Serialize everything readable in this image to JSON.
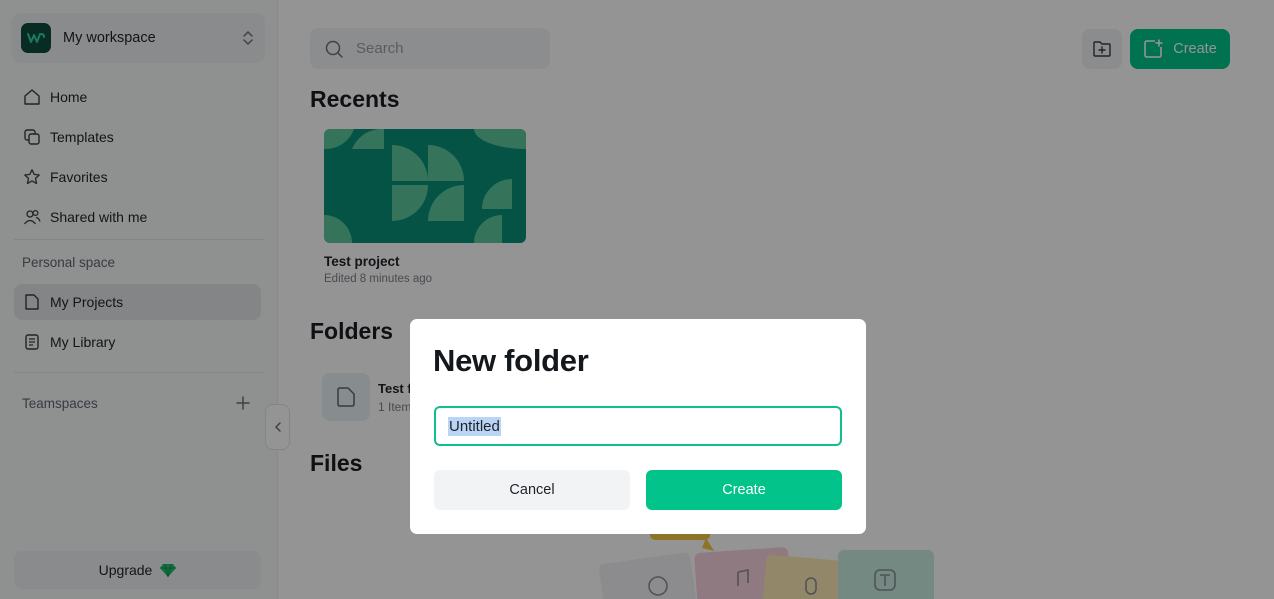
{
  "workspace": {
    "name": "My workspace"
  },
  "sidebar": {
    "nav": [
      {
        "label": "Home",
        "icon": "home-icon"
      },
      {
        "label": "Templates",
        "icon": "templates-icon"
      },
      {
        "label": "Favorites",
        "icon": "star-icon"
      },
      {
        "label": "Shared with me",
        "icon": "users-icon"
      }
    ],
    "personal_label": "Personal space",
    "personal": [
      {
        "label": "My Projects",
        "icon": "projects-icon",
        "active": true
      },
      {
        "label": "My Library",
        "icon": "library-icon",
        "active": false
      }
    ],
    "teamspaces_label": "Teamspaces",
    "upgrade_label": "Upgrade"
  },
  "header": {
    "search_placeholder": "Search",
    "create_label": "Create"
  },
  "recents": {
    "title": "Recents",
    "items": [
      {
        "name": "Test project",
        "edited": "Edited 8 minutes ago"
      }
    ]
  },
  "folders": {
    "title": "Folders",
    "items": [
      {
        "name": "Test f",
        "count": "1 Item"
      }
    ]
  },
  "files": {
    "title": "Files"
  },
  "modal": {
    "title": "New folder",
    "input_value": "Untitled",
    "cancel_label": "Cancel",
    "create_label": "Create"
  },
  "colors": {
    "accent": "#02c48a",
    "thumb_bg": "#0a8f78",
    "thumb_shape": "#5cc79e"
  }
}
